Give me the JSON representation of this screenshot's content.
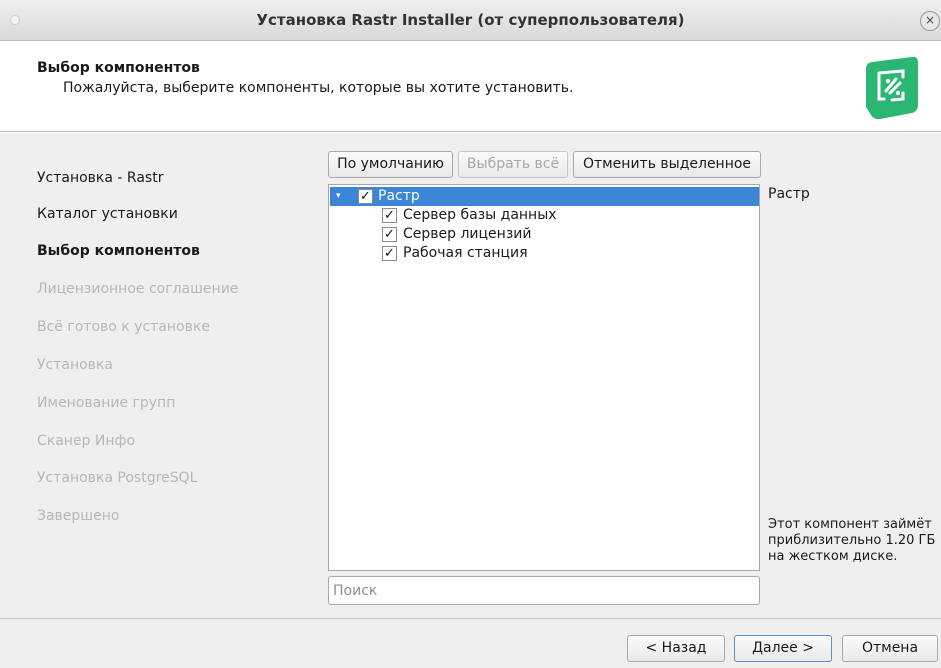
{
  "window": {
    "title": "Установка Rastr Installer (от суперпользователя)",
    "close_glyph": "×"
  },
  "header": {
    "title": "Выбор компонентов",
    "subtitle": "Пожалуйста, выберите компоненты, которые вы хотите установить."
  },
  "steps": [
    {
      "label": "Установка - Rastr",
      "state": "done"
    },
    {
      "label": "Каталог установки",
      "state": "done"
    },
    {
      "label": "Выбор компонентов",
      "state": "current"
    },
    {
      "label": "Лицензионное соглашение",
      "state": "future"
    },
    {
      "label": "Всё готово к установке",
      "state": "future"
    },
    {
      "label": "Установка",
      "state": "future"
    },
    {
      "label": "Именование групп",
      "state": "future"
    },
    {
      "label": "Сканер Инфо",
      "state": "future"
    },
    {
      "label": "Установка PostgreSQL",
      "state": "future"
    },
    {
      "label": "Завершено",
      "state": "future"
    }
  ],
  "toolbar": {
    "default_label": "По умолчанию",
    "select_all_label": "Выбрать всё",
    "deselect_label": "Отменить выделенное"
  },
  "components": [
    {
      "label": "Растр",
      "checked": true,
      "expanded": true,
      "selected": true
    },
    {
      "label": "Сервер базы данных",
      "checked": true
    },
    {
      "label": "Сервер лицензий",
      "checked": true
    },
    {
      "label": "Рабочая станция",
      "checked": true
    }
  ],
  "checkmark": "✓",
  "expand_glyph": "▾",
  "description": {
    "title": "Растр",
    "size_text": "Этот компонент займёт приблизительно 1.20 ГБ на жестком диске."
  },
  "search": {
    "placeholder": "Поиск",
    "value": ""
  },
  "footer": {
    "back_label": "< Назад",
    "next_label": "Далее >",
    "cancel_label": "Отмена"
  },
  "colors": {
    "selection": "#3c86d8",
    "logo": "#2bb673",
    "disabled_text": "#b7b7b7"
  }
}
